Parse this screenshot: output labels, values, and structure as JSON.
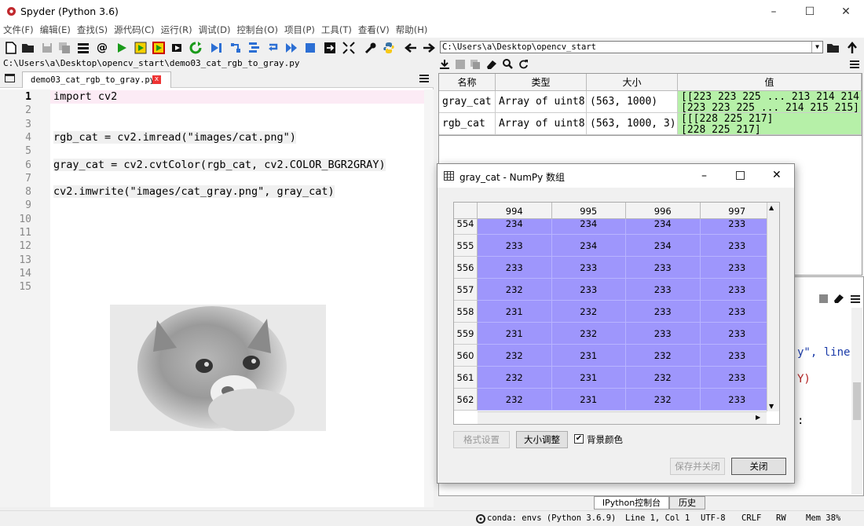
{
  "window": {
    "title": "Spyder (Python 3.6)",
    "min": "–",
    "max": "☐",
    "close": "✕"
  },
  "menu": [
    "文件(F)",
    "编辑(E)",
    "查找(S)",
    "源代码(C)",
    "运行(R)",
    "调试(D)",
    "控制台(O)",
    "项目(P)",
    "工具(T)",
    "查看(V)",
    "帮助(H)"
  ],
  "toolbar": {
    "path": "C:\\Users\\a\\Desktop\\opencv_start"
  },
  "editor": {
    "file_path": "C:\\Users\\a\\Desktop\\opencv_start\\demo03_cat_rgb_to_gray.py",
    "tab_label": "demo03_cat_rgb_to_gray.py",
    "tab_close": "x",
    "line_numbers": [
      "1",
      "2",
      "3",
      "4",
      "5",
      "6",
      "7",
      "8",
      "9",
      "10",
      "11",
      "12",
      "13",
      "14",
      "15"
    ],
    "code_lines": [
      {
        "line": 1,
        "text": "import cv2"
      },
      {
        "line": 4,
        "text": "rgb_cat = cv2.imread(\"images/cat.png\")"
      },
      {
        "line": 6,
        "text": "gray_cat = cv2.cvtColor(rgb_cat, cv2.COLOR_BGR2GRAY)"
      },
      {
        "line": 8,
        "text": "cv2.imwrite(\"images/cat_gray.png\", gray_cat)"
      }
    ]
  },
  "variables": {
    "headers": [
      "名称",
      "类型",
      "大小",
      "值"
    ],
    "rows": [
      {
        "name": "gray_cat",
        "type": "Array of uint8",
        "size": "(563, 1000)",
        "value1": "[[223 223 225 ... 213 214 214]",
        "value2": " [223 223 225 ... 214 215 215]"
      },
      {
        "name": "rgb_cat",
        "type": "Array of uint8",
        "size": "(563, 1000, 3)",
        "value1": "[[[228 225 217]",
        "value2": "  [228 225 217]"
      }
    ]
  },
  "console": {
    "fragment1": "y\", line",
    "fragment2": "Y)",
    "fragment3": ":"
  },
  "console_tabs": [
    "IPython控制台",
    "历史"
  ],
  "status": {
    "env": "conda: envs (Python 3.6.9)",
    "pos": "Line 1, Col 1",
    "encoding": "UTF-8",
    "eol": "CRLF",
    "perm": "RW",
    "mem": "Mem 38%"
  },
  "dialog": {
    "title": "gray_cat - NumPy 数组",
    "columns": [
      "994",
      "995",
      "996",
      "997"
    ],
    "rows": [
      {
        "index": "554",
        "values": [
          "234",
          "234",
          "234",
          "233"
        ]
      },
      {
        "index": "555",
        "values": [
          "233",
          "234",
          "234",
          "233"
        ]
      },
      {
        "index": "556",
        "values": [
          "233",
          "233",
          "233",
          "233"
        ]
      },
      {
        "index": "557",
        "values": [
          "232",
          "233",
          "233",
          "233"
        ]
      },
      {
        "index": "558",
        "values": [
          "231",
          "232",
          "233",
          "233"
        ]
      },
      {
        "index": "559",
        "values": [
          "231",
          "232",
          "233",
          "233"
        ]
      },
      {
        "index": "560",
        "values": [
          "232",
          "231",
          "232",
          "233"
        ]
      },
      {
        "index": "561",
        "values": [
          "232",
          "231",
          "232",
          "233"
        ]
      },
      {
        "index": "562",
        "values": [
          "232",
          "231",
          "232",
          "233"
        ]
      }
    ],
    "format_button": "格式设置",
    "resize_button": "大小调整",
    "bgcolor_label": "背景颜色",
    "bgcolor_checked": true,
    "save_close_button": "保存并关闭",
    "close_button": "关闭",
    "cell_color": "#9e96fc"
  }
}
